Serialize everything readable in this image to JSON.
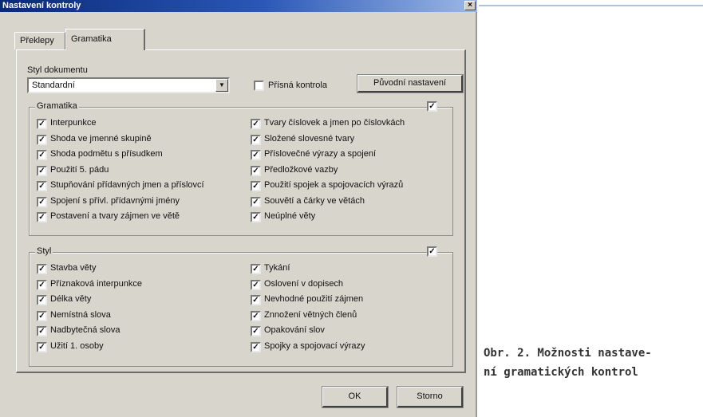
{
  "window": {
    "title": "Nastavení kontroly",
    "close_glyph": "×"
  },
  "tabs": [
    {
      "label": "Překlepy"
    },
    {
      "label": "Gramatika"
    }
  ],
  "style_section": {
    "label": "Styl dokumentu",
    "selected": "Standardní",
    "strict_label": "Přísná kontrola",
    "strict_checked": false,
    "reset_label": "Původní nastavení"
  },
  "grammar": {
    "title": "Gramatika",
    "group_checked": true,
    "left": [
      {
        "label": "Interpunkce",
        "checked": true
      },
      {
        "label": "Shoda ve jmenné skupině",
        "checked": true
      },
      {
        "label": "Shoda podmětu s přísudkem",
        "checked": true
      },
      {
        "label": "Použití 5. pádu",
        "checked": true
      },
      {
        "label": "Stupňování přídavných jmen a příslovcí",
        "checked": true
      },
      {
        "label": "Spojení s přívl. přídavnými jmény",
        "checked": true
      },
      {
        "label": "Postavení a tvary zájmen ve větě",
        "checked": true
      }
    ],
    "right": [
      {
        "label": "Tvary číslovek a jmen po číslovkách",
        "checked": true
      },
      {
        "label": "Složené slovesné tvary",
        "checked": true
      },
      {
        "label": "Příslovečné výrazy a spojení",
        "checked": true
      },
      {
        "label": "Předložkové vazby",
        "checked": true
      },
      {
        "label": "Použití spojek a spojovacích výrazů",
        "checked": true
      },
      {
        "label": "Souvětí a čárky ve větách",
        "checked": true
      },
      {
        "label": "Neúplné věty",
        "checked": true
      }
    ]
  },
  "styl": {
    "title": "Styl",
    "group_checked": true,
    "left": [
      {
        "label": "Stavba věty",
        "checked": true
      },
      {
        "label": "Příznaková interpunkce",
        "checked": true
      },
      {
        "label": "Délka věty",
        "checked": true
      },
      {
        "label": "Nemístná slova",
        "checked": true
      },
      {
        "label": "Nadbytečná slova",
        "checked": true
      },
      {
        "label": "Užití 1. osoby",
        "checked": true
      }
    ],
    "right": [
      {
        "label": "Tykání",
        "checked": true
      },
      {
        "label": "Oslovení v dopisech",
        "checked": true
      },
      {
        "label": "Nevhodné použití zájmen",
        "checked": true
      },
      {
        "label": "Znnožení větných členů",
        "checked": true
      },
      {
        "label": "Opakování slov",
        "checked": true
      },
      {
        "label": "Spojky a spojovací výrazy",
        "checked": true
      }
    ]
  },
  "buttons": {
    "ok": "OK",
    "cancel": "Storno"
  },
  "caption": {
    "line1": "Obr. 2. Možnosti nastave-",
    "line2": "ní gramatických kontrol"
  },
  "colors": {
    "dialog_bg": "#d8d5cd",
    "titlebar": "#0a2a78"
  }
}
